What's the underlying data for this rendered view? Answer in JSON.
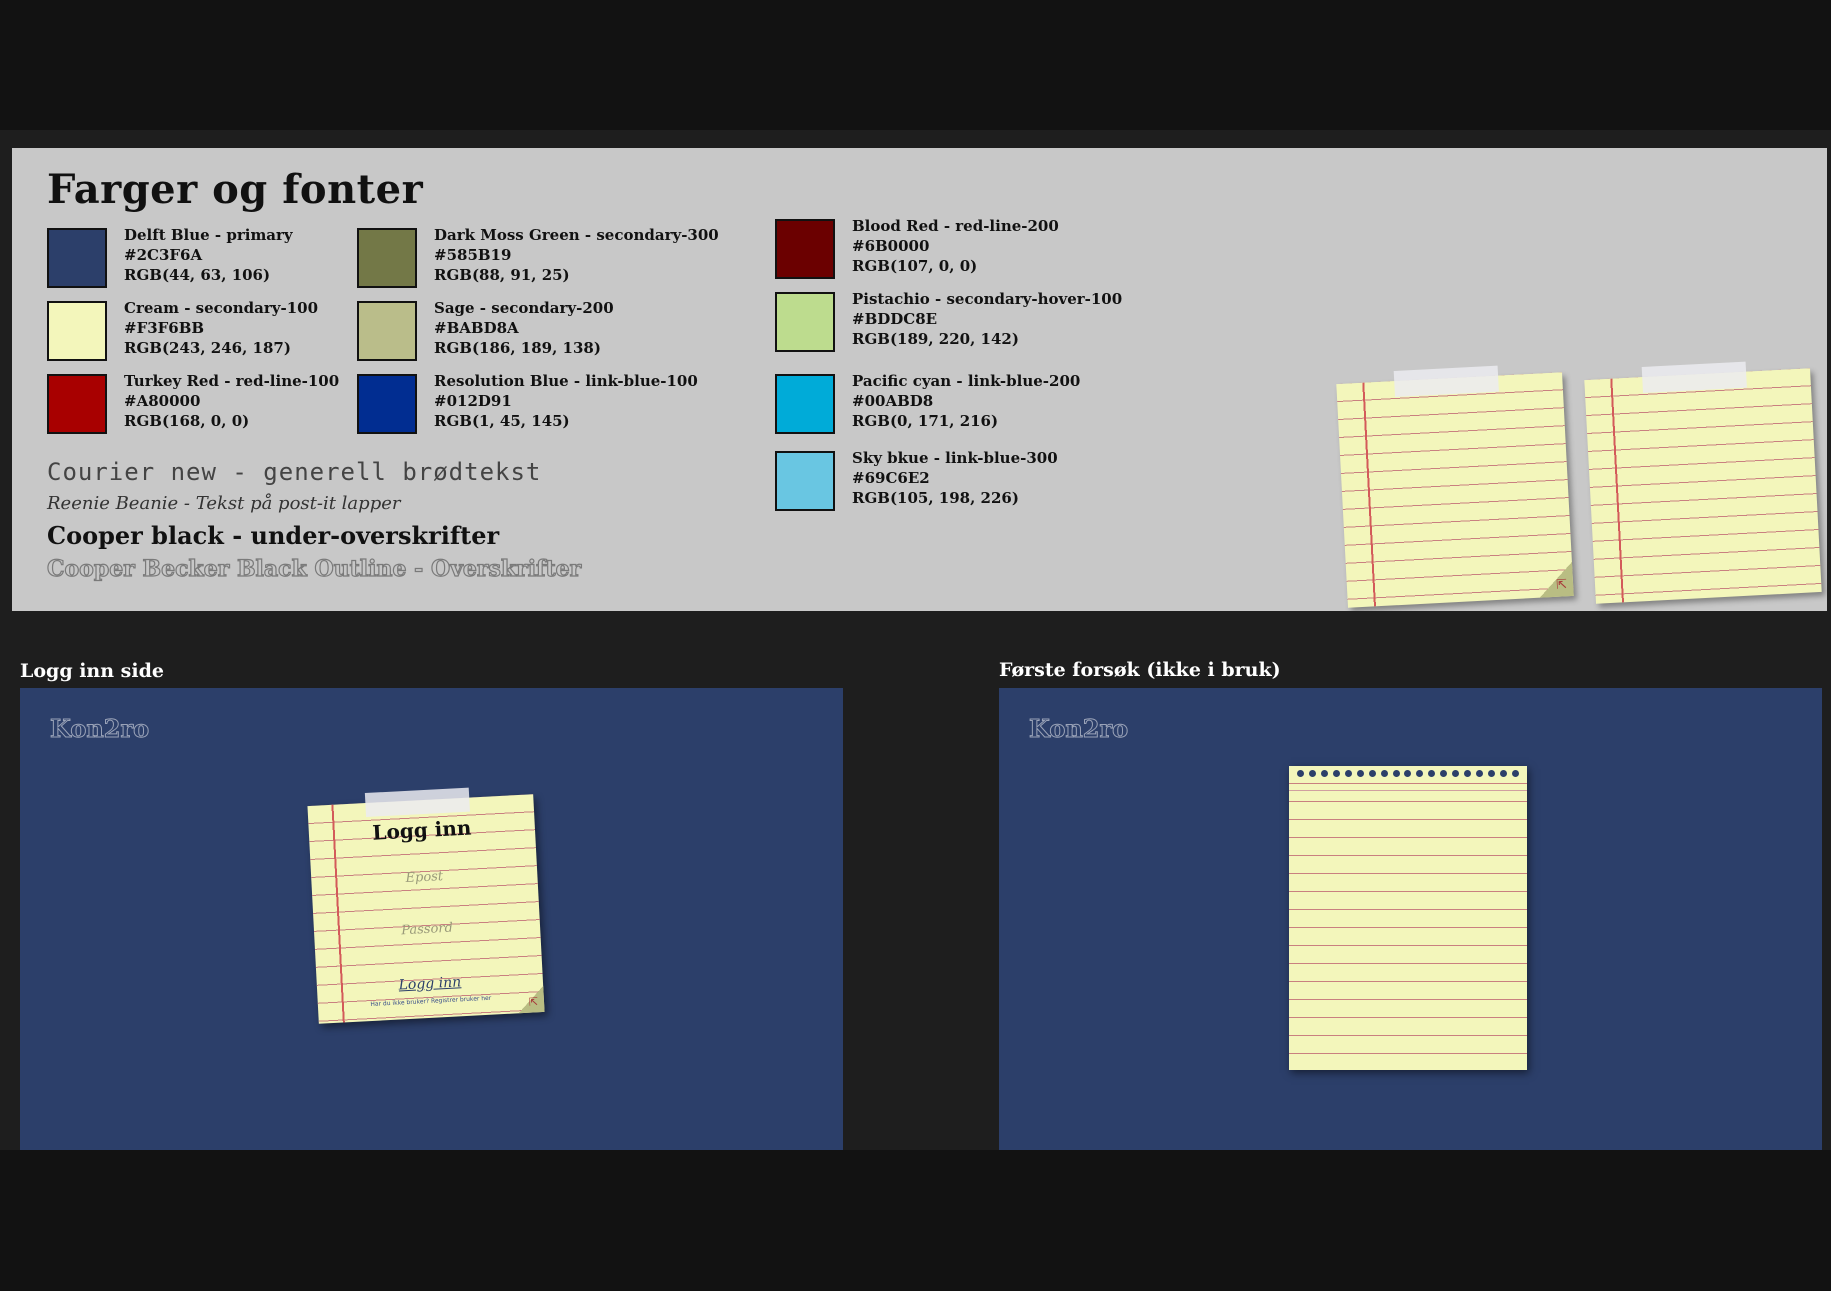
{
  "style_guide": {
    "title": "Farger og fonter",
    "swatches": [
      {
        "name": "Delft Blue - primary",
        "hex": "#2C3F6A",
        "rgb": "RGB(44, 63, 106)",
        "color": "#2C3F6A"
      },
      {
        "name": "Cream - secondary-100",
        "hex": "#F3F6BB",
        "rgb": "RGB(243, 246, 187)",
        "color": "#F3F6BB"
      },
      {
        "name": "Turkey Red - red-line-100",
        "hex": "#A80000",
        "rgb": "RGB(168, 0, 0)",
        "color": "#A80000"
      },
      {
        "name": "Dark Moss Green - secondary-300",
        "hex": "#585B19",
        "rgb": "RGB(88, 91, 25)",
        "color": "#737847"
      },
      {
        "name": "Sage - secondary-200",
        "hex": "#BABD8A",
        "rgb": "RGB(186, 189, 138)",
        "color": "#BABD8A"
      },
      {
        "name": "Resolution Blue - link-blue-100",
        "hex": "#012D91",
        "rgb": "RGB(1, 45, 145)",
        "color": "#012D91"
      },
      {
        "name": "Blood Red - red-line-200",
        "hex": "#6B0000",
        "rgb": "RGB(107, 0, 0)",
        "color": "#6B0000"
      },
      {
        "name": "Pistachio - secondary-hover-100",
        "hex": "#BDDC8E",
        "rgb": "RGB(189, 220, 142)",
        "color": "#BDDC8E"
      },
      {
        "name": "Pacific cyan - link-blue-200",
        "hex": "#00ABD8",
        "rgb": "RGB(0, 171, 216)",
        "color": "#00ABD8"
      },
      {
        "name": "Sky bkue - link-blue-300",
        "hex": "#69C6E2",
        "rgb": "RGB(105, 198, 226)",
        "color": "#69C6E2"
      }
    ],
    "fonts": {
      "courier": "Courier new - generell brødtekst",
      "reenie": "Reenie Beanie - Tekst på post-it lapper",
      "cooper": "Cooper black - under-overskrifter",
      "outline": "Cooper Becker Black Outline - Overskrifter"
    }
  },
  "login_screen": {
    "heading": "Logg inn side",
    "logo": "Kon2ro",
    "note_title": "Logg inn",
    "email_placeholder": "Epost",
    "password_placeholder": "Passord",
    "login_button": "Logg inn",
    "register_link": "Har du ikke bruker? Registrer bruker her"
  },
  "first_attempt_screen": {
    "heading": "Første forsøk (ikke i bruk)",
    "logo": "Kon2ro"
  },
  "colors": {
    "page_bg": "#121212",
    "band_bg": "#1e1e1e",
    "panel_bg": "#c8c8c8",
    "primary": "#2C3F6A",
    "postit": "#F3F6BB"
  }
}
